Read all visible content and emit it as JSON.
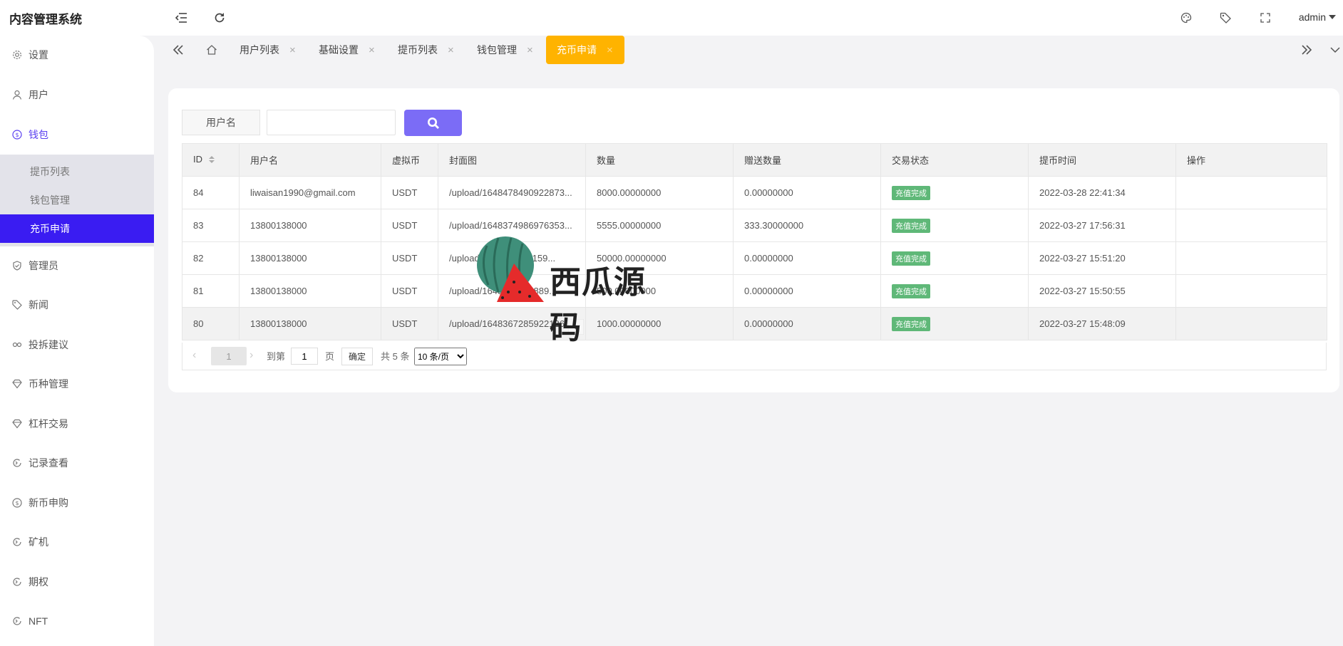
{
  "app": {
    "title": "内容管理系统",
    "user": "admin"
  },
  "sidebar": {
    "items": [
      {
        "label": "设置",
        "icon": "gear-icon"
      },
      {
        "label": "用户",
        "icon": "user-icon"
      },
      {
        "label": "钱包",
        "icon": "coin-icon"
      },
      {
        "label": "管理员",
        "icon": "shield-check-icon"
      },
      {
        "label": "新闻",
        "icon": "tag-icon"
      },
      {
        "label": "投拆建议",
        "icon": "link-icon"
      },
      {
        "label": "币种管理",
        "icon": "diamond-icon"
      },
      {
        "label": "杠杆交易",
        "icon": "diamond-icon"
      },
      {
        "label": "记录查看",
        "icon": "circle-arrow-icon"
      },
      {
        "label": "新币申购",
        "icon": "coin-icon"
      },
      {
        "label": "矿机",
        "icon": "circle-arrow-icon"
      },
      {
        "label": "期权",
        "icon": "circle-arrow-icon"
      },
      {
        "label": "NFT",
        "icon": "circle-arrow-icon"
      }
    ],
    "wallet_sub": [
      "提币列表",
      "钱包管理",
      "充币申请"
    ]
  },
  "tabs": [
    {
      "label": "用户列表"
    },
    {
      "label": "基础设置"
    },
    {
      "label": "提币列表"
    },
    {
      "label": "钱包管理"
    },
    {
      "label": "充币申请"
    }
  ],
  "tab_close": "×",
  "search": {
    "label": "用户名",
    "value": ""
  },
  "table": {
    "columns": [
      "ID",
      "用户名",
      "虚拟币",
      "封面图",
      "数量",
      "赠送数量",
      "交易状态",
      "提币时间",
      "操作"
    ],
    "rows": [
      [
        "84",
        "liwaisan1990@gmail.com",
        "USDT",
        "/upload/1648478490922873...",
        "8000.00000000",
        "0.00000000",
        "充值完成",
        "2022-03-28 22:41:34",
        ""
      ],
      [
        "83",
        "13800138000",
        "USDT",
        "/upload/1648374986976353...",
        "5555.00000000",
        "333.30000000",
        "充值完成",
        "2022-03-27 17:56:31",
        ""
      ],
      [
        "82",
        "13800138000",
        "USDT",
        "/upload/1648368511159...",
        "50000.00000000",
        "0.00000000",
        "充值完成",
        "2022-03-27 15:51:20",
        ""
      ],
      [
        "81",
        "13800138000",
        "USDT",
        "/upload/1648368251889...",
        "500.00000000",
        "0.00000000",
        "充值完成",
        "2022-03-27 15:50:55",
        ""
      ],
      [
        "80",
        "13800138000",
        "USDT",
        "/upload/1648367285922126...",
        "1000.00000000",
        "0.00000000",
        "充值完成",
        "2022-03-27 15:48:09",
        ""
      ]
    ]
  },
  "pager": {
    "current": "1",
    "goto_label": "到第",
    "goto_value": "1",
    "page_unit": "页",
    "confirm": "确定",
    "total": "共 5 条",
    "per_page": "10 条/页"
  },
  "watermark": "西瓜源码",
  "colors": {
    "accent": "#3a1cf2",
    "tab_active": "#ffb300",
    "search_btn": "#7b6cf6",
    "badge": "#5fb878"
  }
}
